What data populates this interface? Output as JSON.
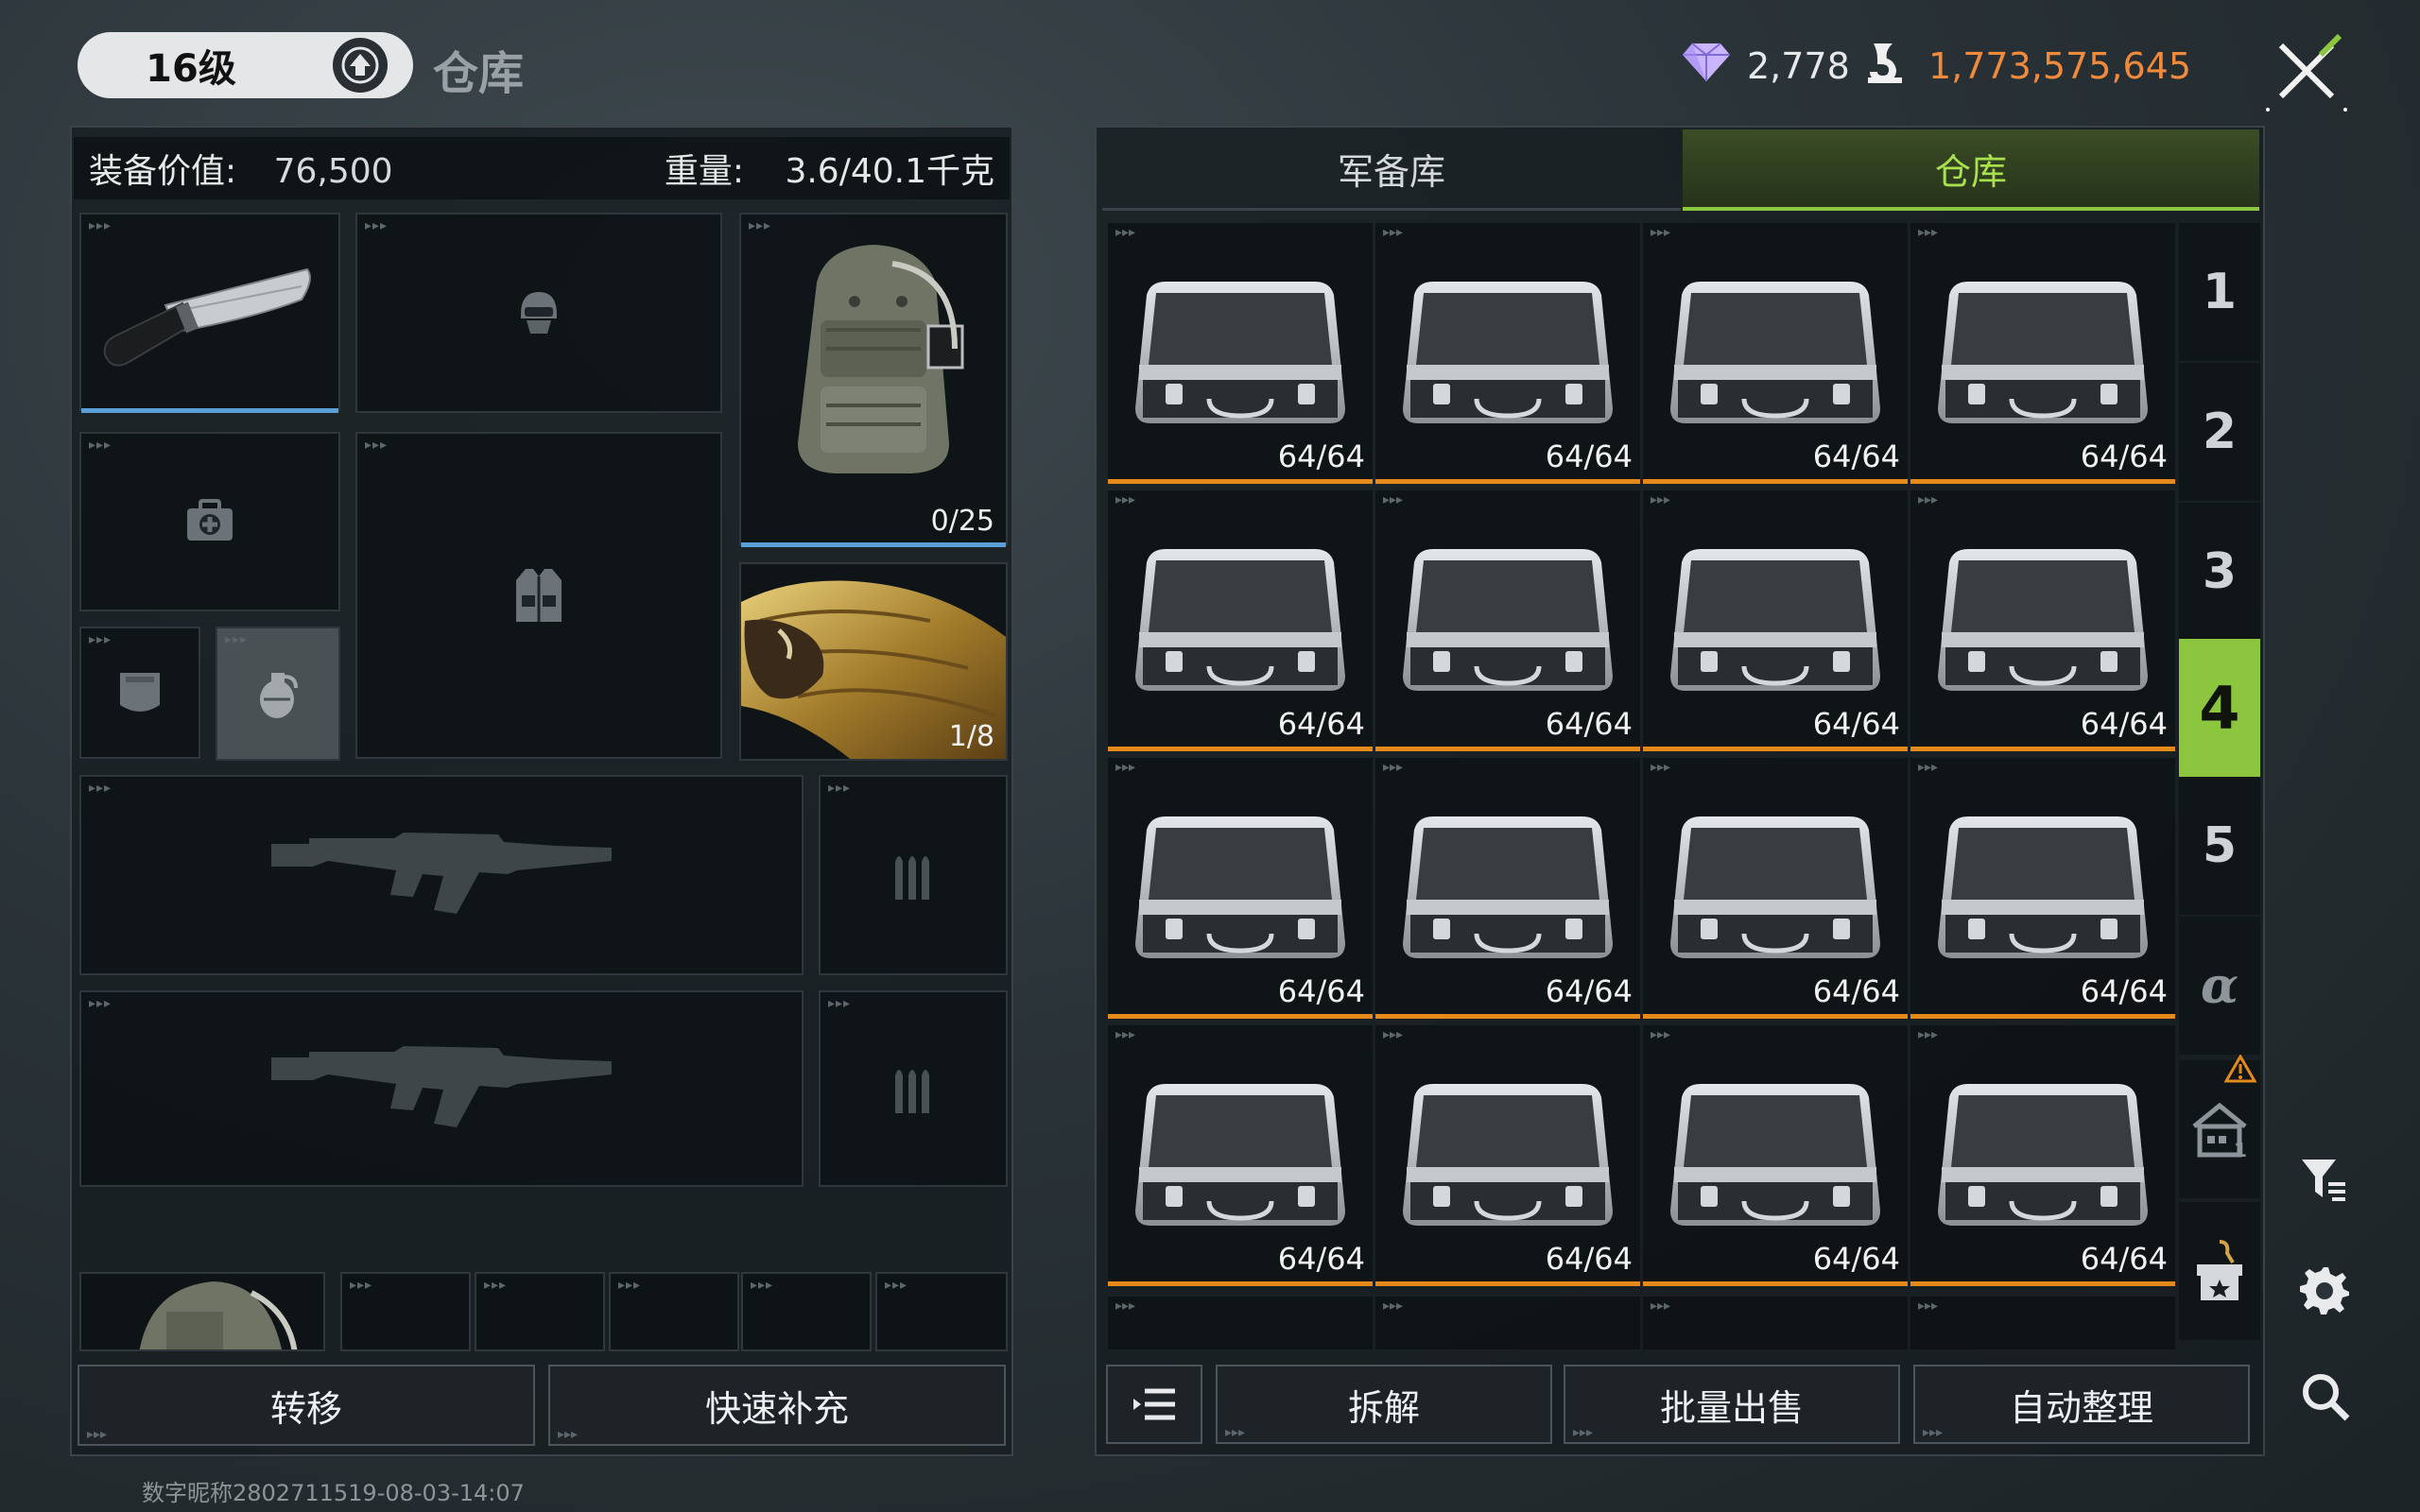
{
  "header": {
    "level_label": "16级",
    "page_title": "仓库",
    "gems": "2,778",
    "coins": "1,773,575,645",
    "coins_color": "#f08a3c"
  },
  "left": {
    "value_label": "装备价值:",
    "value": "76,500",
    "weight_label": "重量:",
    "weight": "3.6/40.1千克",
    "backpack_capacity": "0/25",
    "grenade_count": "1/8"
  },
  "left_buttons": {
    "transfer": "转移",
    "quick_refill": "快速补充"
  },
  "tabs": {
    "armory": "军备库",
    "warehouse": "仓库"
  },
  "grid": {
    "items": [
      "64/64",
      "64/64",
      "64/64",
      "64/64",
      "64/64",
      "64/64",
      "64/64",
      "64/64",
      "64/64",
      "64/64",
      "64/64",
      "64/64",
      "64/64",
      "64/64",
      "64/64",
      "64/64"
    ]
  },
  "side_tabs": [
    "1",
    "2",
    "3",
    "4",
    "5",
    "α"
  ],
  "active_side_tab": "4",
  "right_buttons": {
    "dismantle": "拆解",
    "bulk_sell": "批量出售",
    "auto_sort": "自动整理"
  },
  "footer_id": "数字昵称2802711519-08-03-14:07",
  "colors": {
    "accent_green": "#8cc63f",
    "rarity_orange": "#e58a1a",
    "equipped_blue": "#5a9fd8"
  }
}
